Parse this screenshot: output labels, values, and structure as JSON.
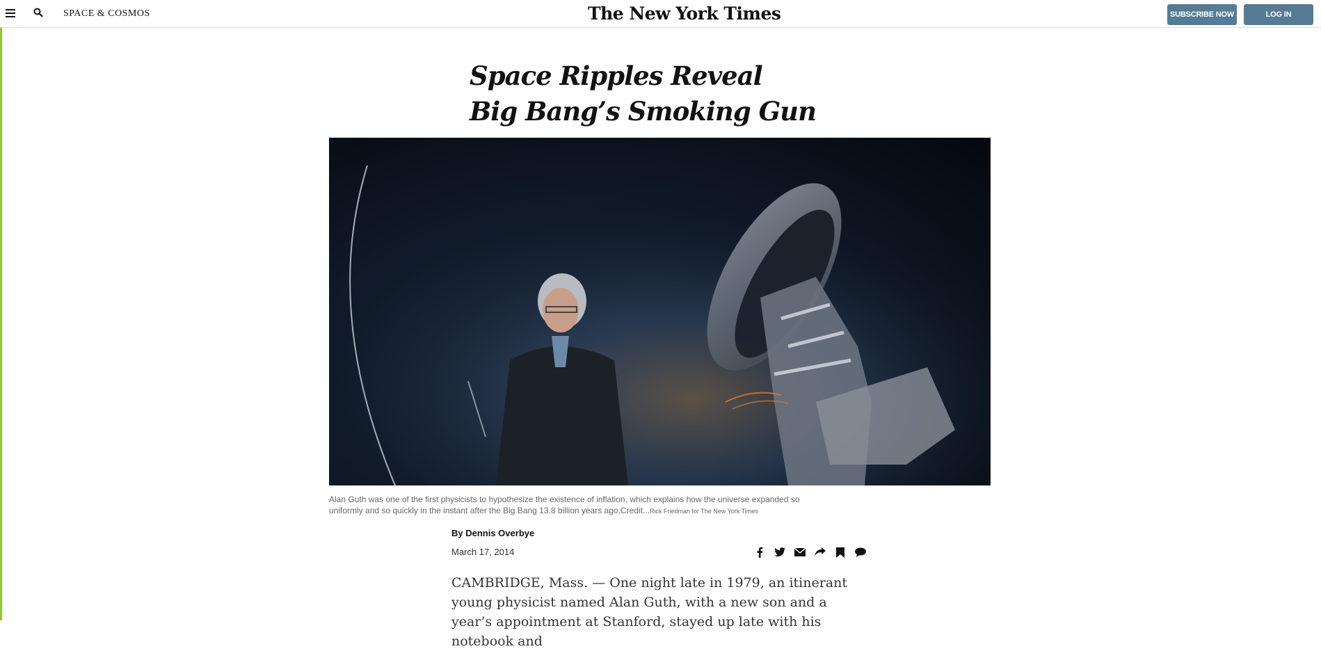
{
  "colors": {
    "accent_rule": "#8cc63f",
    "button_bg": "#567b95",
    "text": "#121212"
  },
  "header": {
    "menu_icon": "hamburger-icon",
    "search_icon": "search-icon",
    "section_label": "SPACE & COSMOS",
    "logo": "The New York Times",
    "subscribe_label": "SUBSCRIBE NOW",
    "login_label": "LOG IN"
  },
  "article": {
    "headline_line1": "Space Ripples Reveal",
    "headline_line2": "Big Bang’s Smoking Gun",
    "caption_text": "Alan Guth was one of the first physicists to hypothesize the existence of inflation, which explains how the universe expanded so uniformly and so quickly in the instant after the Big Bang 13.8 billion years ago.",
    "credit_label": "Credit...",
    "credit_text": "Rick Friedman for The New York Times",
    "byline": "By Dennis Overbye",
    "date": "March 17, 2014",
    "share_icons": [
      "facebook-icon",
      "twitter-icon",
      "email-icon",
      "share-icon",
      "bookmark-icon",
      "comment-icon"
    ],
    "body": "CAMBRIDGE, Mass. — One night late in 1979, an itinerant young physicist named Alan Guth, with a new son and a year’s appointment at Stanford, stayed up late with his notebook and"
  }
}
